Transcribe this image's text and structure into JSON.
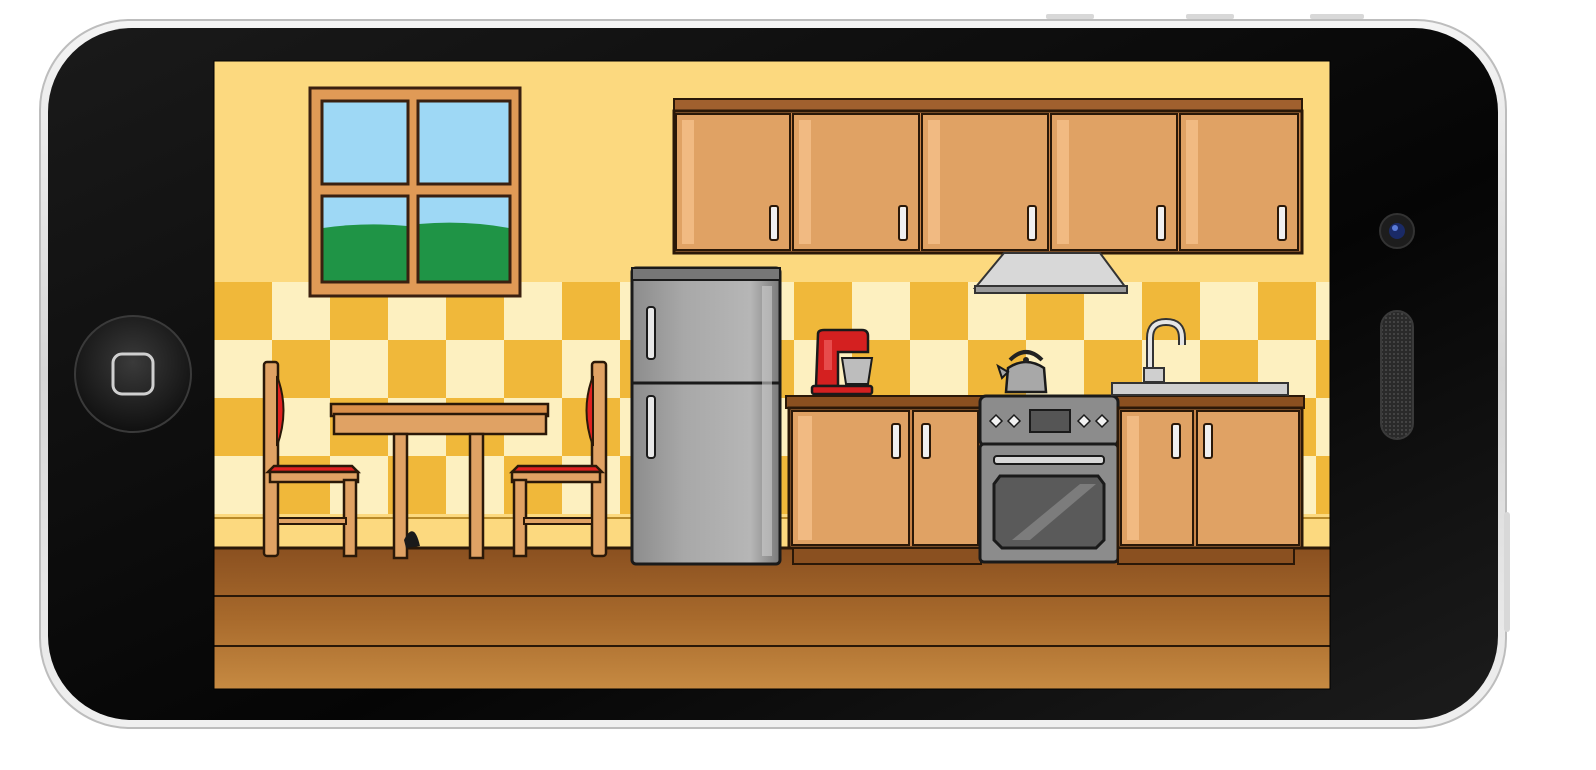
{
  "device": {
    "type": "smartphone",
    "orientation": "landscape",
    "color_body": "#0d0d0d",
    "color_frame": "#e4e4e4",
    "home_button_icon": "rounded-square-icon",
    "camera_icon": "camera-lens-icon",
    "speaker_icon": "speaker-grille-icon"
  },
  "scene": {
    "name": "kitchen",
    "colors": {
      "wall": "#fcd97f",
      "tile_dark": "#f0b83a",
      "tile_light": "#fdf0c0",
      "floor": "#a86a2c",
      "cabinet": "#e0a264",
      "cabinet_edge": "#a0602e",
      "steel": "#9c9c9c",
      "sky": "#9ed8f5",
      "grass": "#1f9446",
      "chair_seat": "#e02020",
      "mixer": "#d42020"
    },
    "objects": [
      "window",
      "upper-cabinets",
      "range-hood",
      "refrigerator",
      "stand-mixer",
      "kettle",
      "stove-oven",
      "sink-faucet",
      "lower-cabinets",
      "dining-table",
      "chair-left",
      "chair-right"
    ]
  }
}
